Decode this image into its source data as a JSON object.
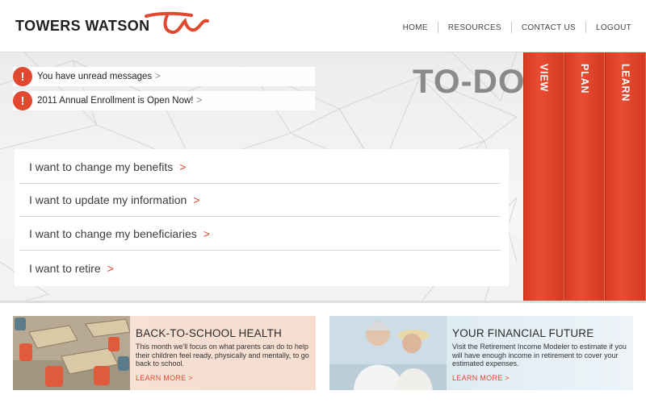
{
  "header": {
    "logo_text": "TOWERS WATSON",
    "nav": [
      "HOME",
      "RESOURCES",
      "CONTACT US",
      "LOGOUT"
    ]
  },
  "alerts": [
    {
      "icon": "!",
      "text": "You have unread messages",
      "chevron": ">"
    },
    {
      "icon": "!",
      "text": "2011 Annual Enrollment is Open Now!",
      "chevron": ">"
    }
  ],
  "todo": {
    "title": "TO-DO"
  },
  "actions": [
    {
      "label": "I want to change my benefits",
      "chevron": ">"
    },
    {
      "label": "I want to update my information",
      "chevron": ">"
    },
    {
      "label": "I want to change my beneficiaries",
      "chevron": ">"
    },
    {
      "label": "I want to retire",
      "chevron": ">"
    }
  ],
  "tabs": [
    "VIEW",
    "PLAN",
    "LEARN"
  ],
  "promos": {
    "left": {
      "title": "BACK-TO-SCHOOL HEALTH",
      "text": "This month we'll focus on what parents can do to help their children feel ready, physically and mentally, to go back to school.",
      "link": "LEARN MORE >"
    },
    "right": {
      "title": "YOUR FINANCIAL FUTURE",
      "text": "Visit the Retirement Income Modeler to estimate if you will have enough income in retirement to cover your estimated expenses.",
      "link": "LEARN MORE >"
    }
  },
  "colors": {
    "brand_red": "#e0482f",
    "tab_red": "#d93b22"
  }
}
